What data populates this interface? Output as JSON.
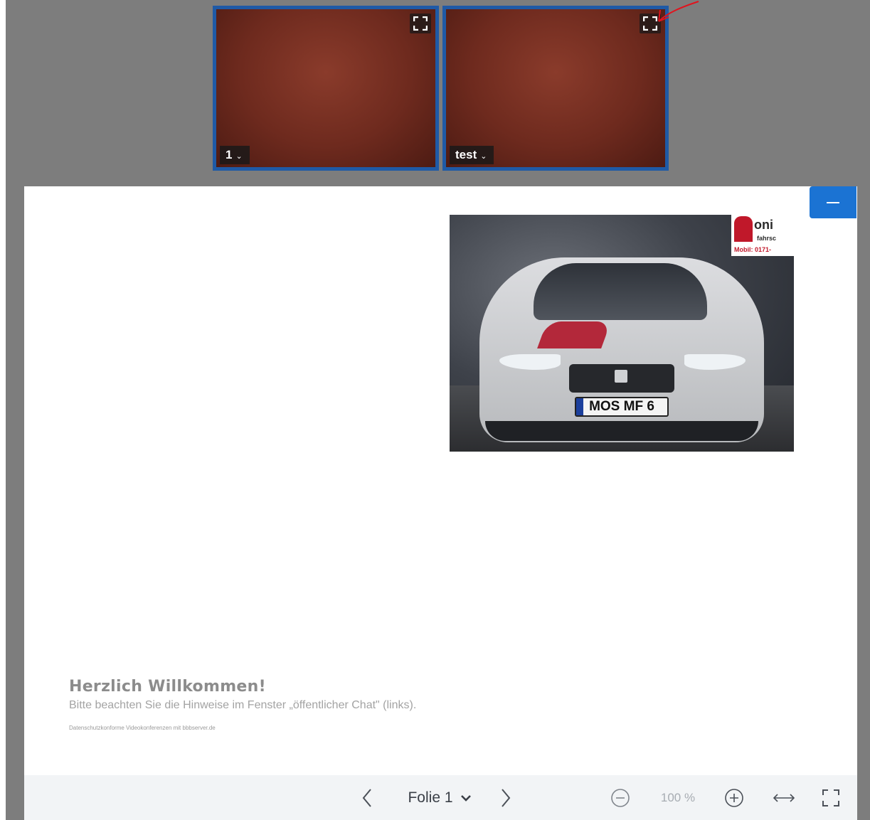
{
  "videos": [
    {
      "user": "1",
      "fullscreen_icon": "fullscreen-icon",
      "dropdown_icon": "chevron-down-icon"
    },
    {
      "user": "test",
      "fullscreen_icon": "fullscreen-icon",
      "dropdown_icon": "chevron-down-icon"
    }
  ],
  "presentation": {
    "minimize_icon": "minus-icon",
    "image_logo_text": "oni",
    "image_logo_sub": "fahrsc",
    "image_logo_phone": "Mobil: 0171-",
    "image_plate": "MOS MF 6",
    "welcome_title": "Herzlich Willkommen!",
    "welcome_text": "Bitte beachten Sie die Hinweise im Fenster „öffentlicher Chat\" (links).",
    "fine_print": "Datenschutzkonforme Videokonferenzen mit bbbserver.de"
  },
  "toolbar": {
    "prev_icon": "chevron-left-icon",
    "slide_label": "Folie 1",
    "slide_dropdown_icon": "chevron-down-icon",
    "next_icon": "chevron-right-icon",
    "zoom_out_icon": "zoom-out-icon",
    "zoom_value": "100 %",
    "zoom_in_icon": "zoom-in-icon",
    "fit_width_icon": "fit-width-icon",
    "fullscreen_icon": "fullscreen-icon"
  },
  "colors": {
    "tile_border": "#1f5aa6",
    "minimize_button": "#1b73d3",
    "app_background": "#7d7d7d",
    "toolbar_background": "#f2f4f6",
    "annotation": "#e0141e"
  }
}
